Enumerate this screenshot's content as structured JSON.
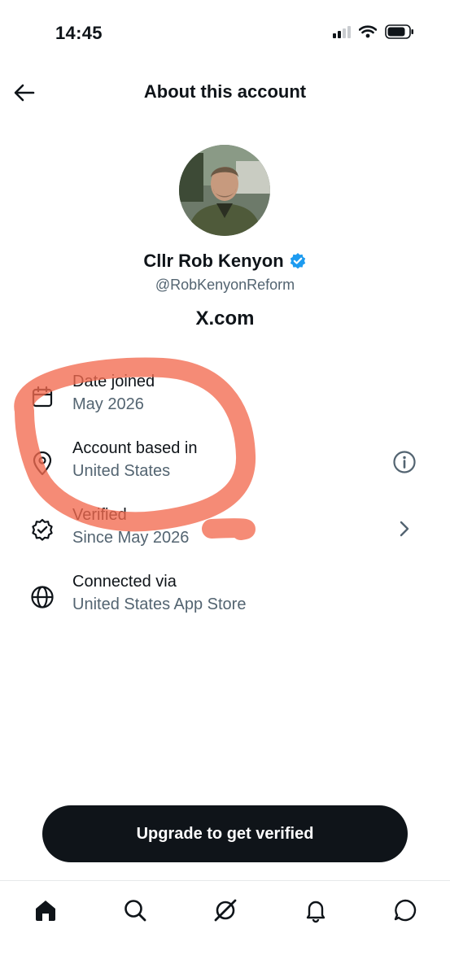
{
  "status_bar": {
    "time": "14:45",
    "icons": [
      "cellular-signal-icon",
      "wifi-icon",
      "battery-icon"
    ]
  },
  "header": {
    "title": "About this account",
    "back_icon": "arrow-left-icon"
  },
  "profile": {
    "display_name": "Cllr Rob Kenyon",
    "verified_badge": "verified-badge-icon",
    "handle": "@RobKenyonReform",
    "site": "X.com"
  },
  "details": [
    {
      "icon": "calendar-icon",
      "title": "Date joined",
      "value": "May 2026"
    },
    {
      "icon": "location-pin-icon",
      "title": "Account based in",
      "value": "United States",
      "action_icon": "info-icon"
    },
    {
      "icon": "verified-badge-outline-icon",
      "title": "Verified",
      "value": "Since May 2026",
      "action_icon": "chevron-right-icon"
    },
    {
      "icon": "globe-icon",
      "title": "Connected via",
      "value": "United States App Store"
    }
  ],
  "cta": {
    "label": "Upgrade to get verified"
  },
  "tabbar": {
    "tabs": [
      "home-icon",
      "search-icon",
      "grok-icon",
      "notifications-bell-icon",
      "messages-icon"
    ]
  },
  "colors": {
    "text": "#0f1419",
    "secondary_text": "#536471",
    "verified_blue": "#1d9bf0",
    "highlight_marker": "#f26a4f"
  }
}
